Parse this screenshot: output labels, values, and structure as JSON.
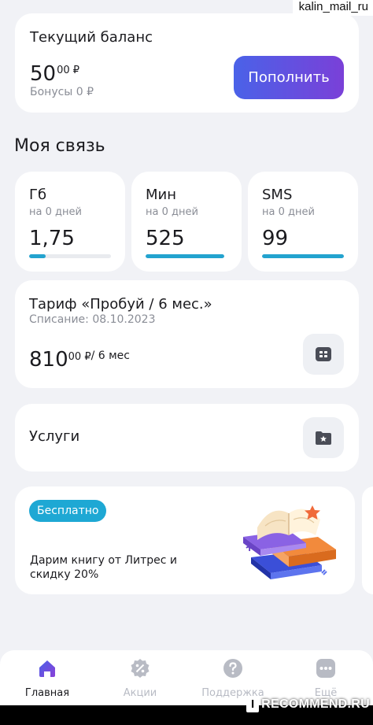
{
  "watermark": "kalin_mail_ru",
  "balance": {
    "title": "Текущий баланс",
    "amount_main": "50",
    "amount_cents": "00 ₽",
    "bonus": "Бонусы 0 ₽",
    "topup_label": "Пополнить"
  },
  "section_title": "Моя связь",
  "tiles": [
    {
      "label": "Гб",
      "sub": "на 0 дней",
      "value": "1,75",
      "progress": 0.2
    },
    {
      "label": "Мин",
      "sub": "на 0 дней",
      "value": "525",
      "progress": 1.0
    },
    {
      "label": "SMS",
      "sub": "на 0 дней",
      "value": "99",
      "progress": 1.0
    }
  ],
  "tariff": {
    "title": "Тариф «Пробуй / 6 мес.»",
    "charge_date": "Списание: 08.10.2023",
    "price_main": "810",
    "price_cents": "00 ₽",
    "price_period": "/ 6 мес",
    "icon": "sim-card-icon"
  },
  "services": {
    "label": "Услуги",
    "icon": "folder-star-icon"
  },
  "promo": {
    "badge": "Бесплатно",
    "text": "Дарим книгу от Литрес и скидку 20%",
    "art": "books-illustration"
  },
  "nav": [
    {
      "label": "Главная",
      "icon": "home-icon",
      "active": true
    },
    {
      "label": "Акции",
      "icon": "percent-icon",
      "active": false
    },
    {
      "label": "Поддержка",
      "icon": "help-icon",
      "active": false
    },
    {
      "label": "Ещё",
      "icon": "more-icon",
      "active": false
    }
  ],
  "recommend_watermark": "RECOMMEND.RU",
  "colors": {
    "accent_blue": "#23a3cf",
    "button_gradient_start": "#4a62e8",
    "button_gradient_end": "#7a40d8",
    "active_nav": "#6a3fd8"
  }
}
